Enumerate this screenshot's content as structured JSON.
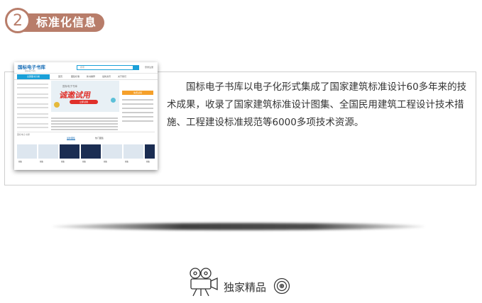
{
  "section": {
    "number": "2",
    "title": "标准化信息"
  },
  "content": {
    "description": "国标电子书库以电子化形式集成了国家建筑标准设计60多年来的技术成果，收录了国家建筑标准设计图集、全国民用建筑工程设计技术措施、工程建设标准规范等6000多项技术资源。"
  },
  "thumbnail": {
    "logo": "国标电子书库",
    "logo_sub": "国标电子书库",
    "search_placeholder": "搜索",
    "login": "登录注册",
    "category": "全部图书分类",
    "nav_items": [
      "首页",
      "图集标准",
      "新书推荐",
      "最新资讯",
      "关于我们"
    ],
    "banner_small": "国标电子书库",
    "banner_big": "诚邀试用",
    "banner_button": "立即试用",
    "right_button": "免费试用",
    "bar_text": "国标电子书库",
    "tabs": [
      "最新图集",
      "热门图集"
    ],
    "card_labels": [
      "图集",
      "图集",
      "图集",
      "图集",
      "图集",
      "图集",
      "图集"
    ]
  },
  "footer": {
    "label": "独家精品"
  },
  "colors": {
    "accent": "#b87d6a",
    "border": "#cfcfcf",
    "thumb_blue": "#1aa0d8",
    "thumb_red": "#e0302a"
  }
}
